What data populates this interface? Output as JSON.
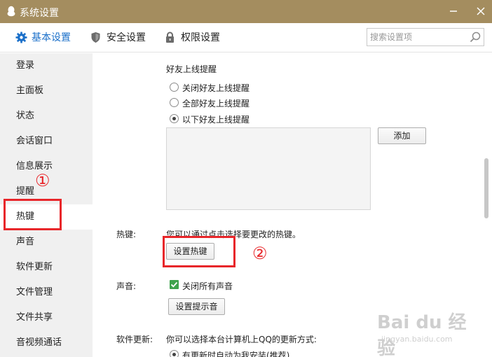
{
  "window": {
    "title": "系统设置"
  },
  "tabs": [
    {
      "label": "基本设置",
      "icon": "gear-icon",
      "active": true
    },
    {
      "label": "安全设置",
      "icon": "shield-icon",
      "active": false
    },
    {
      "label": "权限设置",
      "icon": "lock-icon",
      "active": false
    }
  ],
  "search": {
    "placeholder": "搜索设置项",
    "value": ""
  },
  "sidebar": {
    "items": [
      {
        "label": "登录"
      },
      {
        "label": "主面板"
      },
      {
        "label": "状态"
      },
      {
        "label": "会话窗口"
      },
      {
        "label": "信息展示"
      },
      {
        "label": "提醒"
      },
      {
        "label": "热键",
        "active": true
      },
      {
        "label": "声音"
      },
      {
        "label": "软件更新"
      },
      {
        "label": "文件管理"
      },
      {
        "label": "文件共享"
      },
      {
        "label": "音视频通话"
      }
    ]
  },
  "annotations": {
    "one": "①",
    "two": "②",
    "color": "#e8262a"
  },
  "content": {
    "friend_online": {
      "heading": "好友上线提醒",
      "options": [
        {
          "label": "关闭好友上线提醒",
          "checked": false
        },
        {
          "label": "全部好友上线提醒",
          "checked": false
        },
        {
          "label": "以下好友上线提醒",
          "checked": true
        }
      ],
      "add_button": "添加"
    },
    "hotkey": {
      "label": "热键:",
      "description": "您可以通过点击选择要更改的热键。",
      "button": "设置热键"
    },
    "sound": {
      "label": "声音:",
      "checkbox_label": "关闭所有声音",
      "checked": true,
      "button": "设置提示音"
    },
    "update": {
      "label": "软件更新:",
      "description": "你可以选择本台计算机上QQ的更新方式:",
      "partial_option": "有更新时自动为我安装(推荐)"
    }
  },
  "watermark": {
    "text": "Bai du 经验",
    "url": "jingyan.baidu.com"
  },
  "colors": {
    "titlebar": "#a48d5f",
    "accent": "#1a6fc9",
    "checkbox": "#3fa34d"
  }
}
